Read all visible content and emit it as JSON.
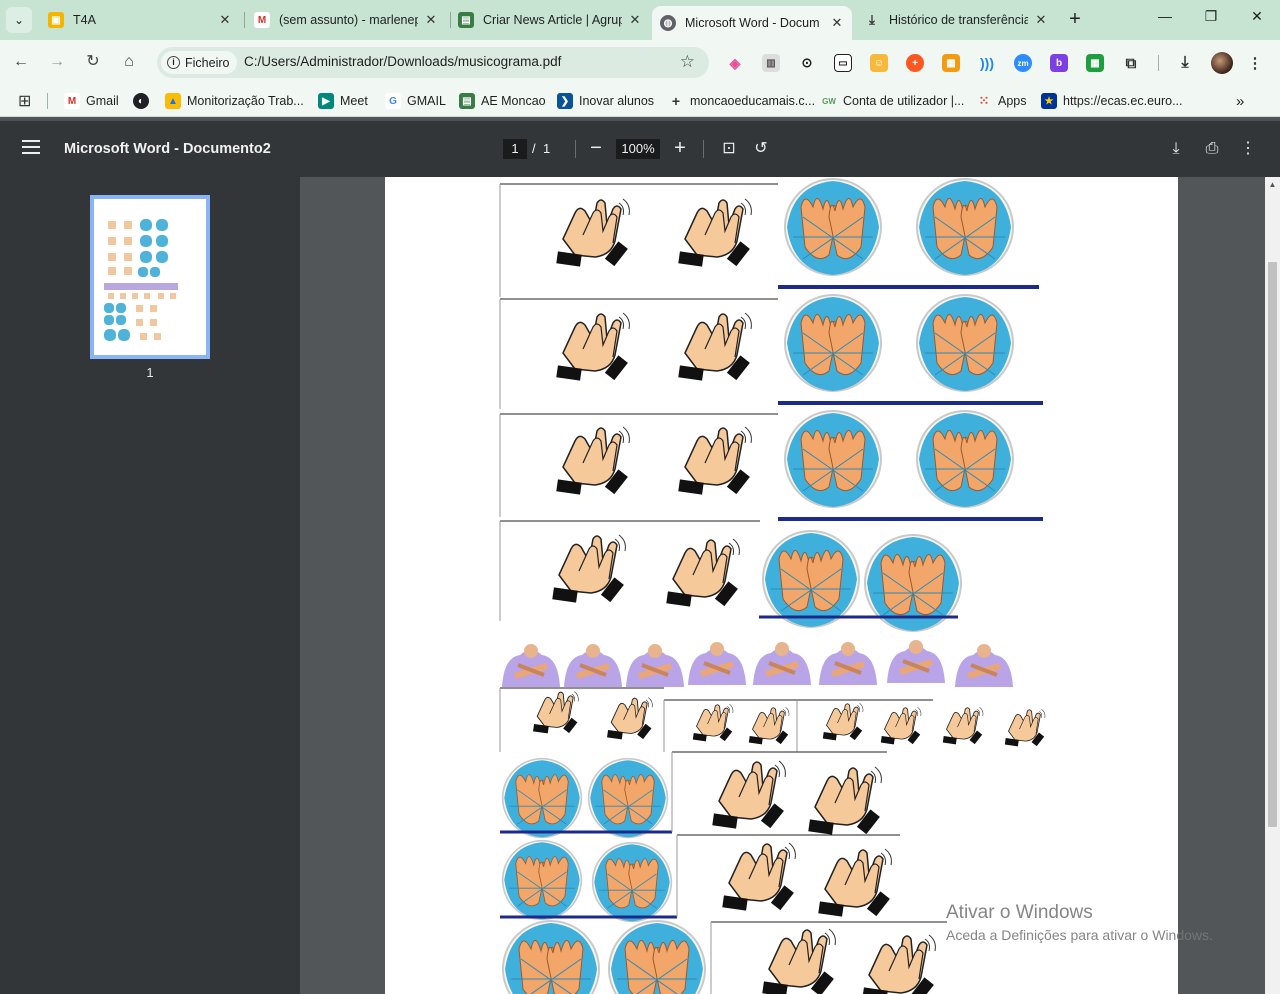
{
  "browser": {
    "tabs": [
      {
        "title": "T4A",
        "icon": "classroom-icon",
        "color": "#f4b400"
      },
      {
        "title": "(sem assunto) - marlenep",
        "icon": "gmail-icon",
        "color": "#d93025"
      },
      {
        "title": "Criar News Article | Agrup",
        "icon": "site-icon",
        "color": "#3a7d44"
      },
      {
        "title": "Microsoft Word - Docum",
        "icon": "globe-icon",
        "color": "#5f6368"
      },
      {
        "title": "Histórico de transferência",
        "icon": "download-icon",
        "color": "#333333"
      }
    ],
    "address": {
      "chip_label": "Ficheiro",
      "url": "C:/Users/Administrador/Downloads/musicograma.pdf"
    },
    "bookmarks": [
      {
        "label": "Gmail",
        "color": "#d93025"
      },
      {
        "label": "",
        "color": "#202124"
      },
      {
        "label": "Monitorização Trab...",
        "color": "#1a73e8"
      },
      {
        "label": "Meet",
        "color": "#00897b"
      },
      {
        "label": "GMAIL",
        "color": "#4285f4"
      },
      {
        "label": "AE Moncao",
        "color": "#3a7d44"
      },
      {
        "label": "Inovar alunos",
        "color": "#0b5394"
      },
      {
        "label": "moncaoeducamais.c...",
        "color": "#333333"
      },
      {
        "label": "Conta de utilizador |...",
        "color": "#5a9a5a"
      },
      {
        "label": "Apps",
        "color": "#ea4335"
      },
      {
        "label": "https://ecas.ec.euro...",
        "color": "#003399"
      }
    ]
  },
  "pdf": {
    "title": "Microsoft Word - Documento2",
    "page_current": "1",
    "page_separator": "/",
    "page_total": "1",
    "zoom": "100%",
    "thumbnail_label": "1"
  },
  "watermark": {
    "title": "Ativar o Windows",
    "subtitle": "Aceda a Definições para ativar o Windows."
  }
}
